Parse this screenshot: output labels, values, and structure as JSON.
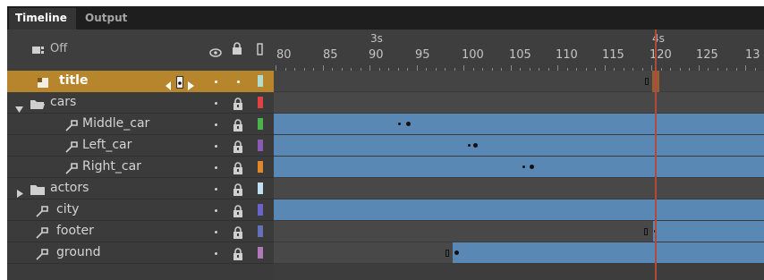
{
  "tabs": [
    {
      "label": "Timeline",
      "active": true
    },
    {
      "label": "Output",
      "active": false
    }
  ],
  "header": {
    "show_all_label": "Off",
    "eye_icon": "eye-icon",
    "lock_icon": "lock-icon",
    "outline_icon": "outline-icon"
  },
  "ruler": {
    "seconds": [
      {
        "label": "3s",
        "frame": 90
      },
      {
        "label": "4s",
        "frame": 120
      }
    ],
    "numbers": [
      "80",
      "85",
      "90",
      "95",
      "100",
      "105",
      "110",
      "115",
      "120",
      "125",
      "13"
    ],
    "playhead_frame": 120,
    "playhead_color": "#b04a3a"
  },
  "layers": [
    {
      "name": "title",
      "type": "layer",
      "selected": true,
      "color": "#b0dcd4"
    },
    {
      "name": "cars",
      "type": "folder-open",
      "selected": false,
      "color": "#e14141"
    },
    {
      "name": "Middle_car",
      "type": "motion-guided",
      "selected": false,
      "color": "#4cb24c"
    },
    {
      "name": "Left_car",
      "type": "motion-guided",
      "selected": false,
      "color": "#8a5bb1"
    },
    {
      "name": "Right_car",
      "type": "motion-guided",
      "selected": false,
      "color": "#e2882a"
    },
    {
      "name": "actors",
      "type": "folder-closed",
      "selected": false,
      "color": "#c0e0f0"
    },
    {
      "name": "city",
      "type": "guide",
      "selected": false,
      "color": "#6c63c9"
    },
    {
      "name": "footer",
      "type": "guide",
      "selected": false,
      "color": "#6470b8"
    },
    {
      "name": "ground",
      "type": "guide",
      "selected": false,
      "color": "#b07ab8"
    }
  ],
  "colors": {
    "accent": "#b7862c",
    "tween": "#5a88b5",
    "panel": "#3b3b3b"
  }
}
